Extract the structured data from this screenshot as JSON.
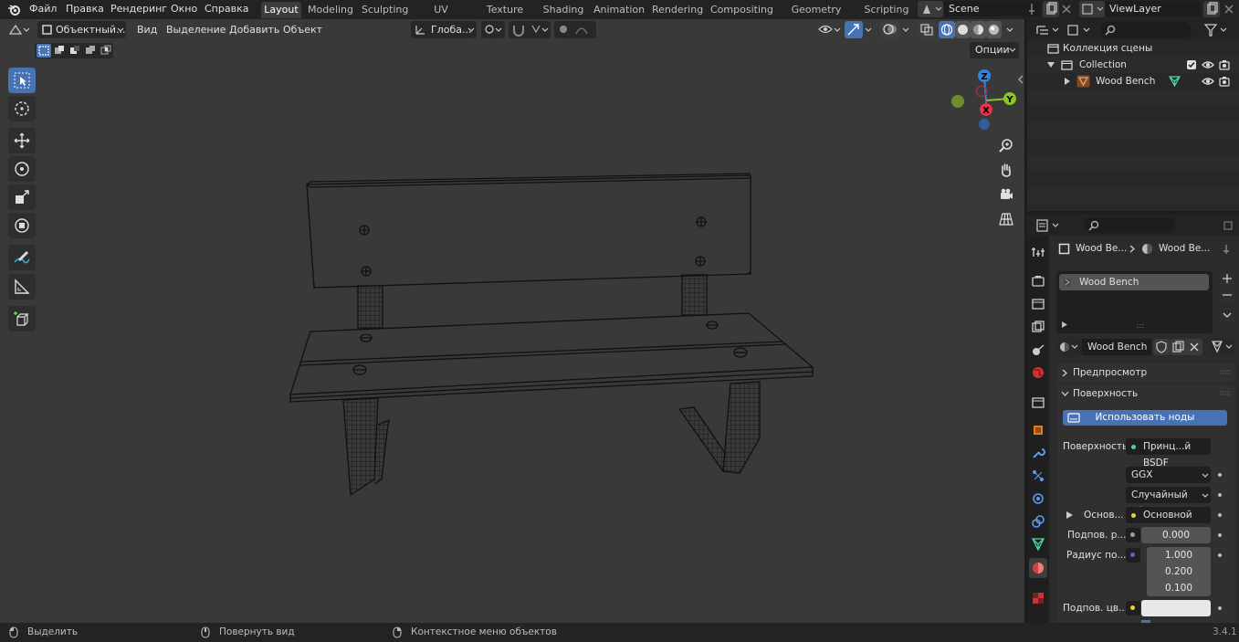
{
  "topbar": {
    "menus": [
      "Файл",
      "Правка",
      "Рендеринг",
      "Окно",
      "Справка"
    ],
    "workspaces": [
      "Layout",
      "Modeling",
      "Sculpting",
      "UV Editing",
      "Texture Paint",
      "Shading",
      "Animation",
      "Rendering",
      "Compositing",
      "Geometry Nodes",
      "Scripting"
    ],
    "active_workspace": "Layout",
    "scene": "Scene",
    "view_layer": "ViewLayer"
  },
  "viewport_header": {
    "mode": "Объектный...",
    "menus": [
      "Вид",
      "Выделение",
      "Добавить",
      "Объект"
    ],
    "orientation": "Глоба...",
    "options": "Опции"
  },
  "gizmo": {
    "z": "Z",
    "y": "Y",
    "x": "X"
  },
  "outliner": {
    "title": "Коллекция сцены",
    "collection": "Collection",
    "object": "Wood Bench"
  },
  "properties": {
    "breadcrumb_object": "Wood Be...",
    "breadcrumb_material": "Wood Be...",
    "slot": "Wood Bench",
    "material_name": "Wood Bench",
    "preview_label": "Предпросмотр",
    "surface_panel": "Поверхность",
    "use_nodes": "Использовать ноды",
    "surface_label": "Поверхность",
    "surface_value": "Принц...й BSDF",
    "distribution": "GGX",
    "subsurface_method": "Случайный об...",
    "base_color_label": "Основ...",
    "base_color_value": "Основной цвет",
    "subsurface_label": "Подпов. р...",
    "subsurface_value": "0.000",
    "radius_label": "Радиус по...",
    "radius_values": [
      "1.000",
      "0.200",
      "0.100"
    ],
    "subsurface_color_label": "Подпов. цв..."
  },
  "statusbar": {
    "select": "Выделить",
    "rotate": "Повернуть вид",
    "context": "Контекстное меню объектов",
    "version": "3.4.1"
  },
  "colors": {
    "accent": "#4772b3",
    "viewport_bg": "#393939",
    "axis_x": "#e0364a",
    "axis_y": "#8ac32b",
    "axis_z": "#2f84e3"
  }
}
